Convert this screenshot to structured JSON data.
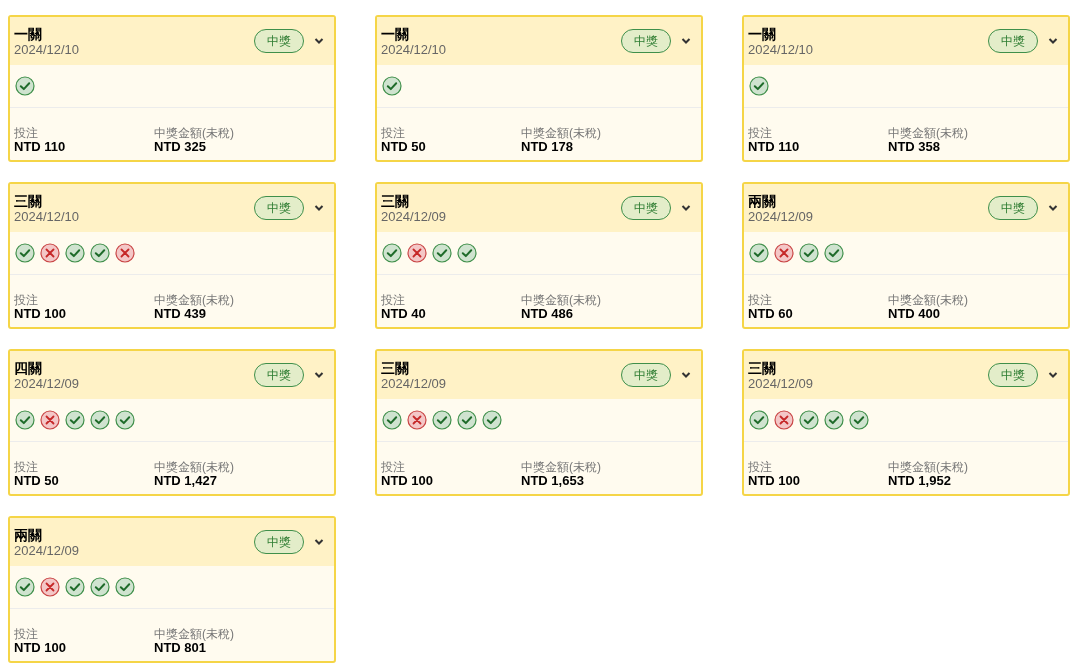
{
  "cards": [
    {
      "title": "一關",
      "date": "2024/12/10",
      "badge": "中獎",
      "results": [
        {
          "correct": true
        }
      ],
      "bet_label": "投注",
      "bet": "NTD 110",
      "prize_label": "中獎金額(未稅)",
      "prize": "NTD 325"
    },
    {
      "title": "一關",
      "date": "2024/12/10",
      "badge": "中獎",
      "results": [
        {
          "correct": true
        }
      ],
      "bet_label": "投注",
      "bet": "NTD 50",
      "prize_label": "中獎金額(未稅)",
      "prize": "NTD 178"
    },
    {
      "title": "一關",
      "date": "2024/12/10",
      "badge": "中獎",
      "results": [
        {
          "correct": true
        }
      ],
      "bet_label": "投注",
      "bet": "NTD 110",
      "prize_label": "中獎金額(未稅)",
      "prize": "NTD 358"
    },
    {
      "title": "三關",
      "date": "2024/12/10",
      "badge": "中獎",
      "results": [
        {
          "correct": true
        },
        {
          "correct": false
        },
        {
          "correct": true
        },
        {
          "correct": true
        },
        {
          "correct": false
        }
      ],
      "bet_label": "投注",
      "bet": "NTD 100",
      "prize_label": "中獎金額(未稅)",
      "prize": "NTD 439"
    },
    {
      "title": "三關",
      "date": "2024/12/09",
      "badge": "中獎",
      "results": [
        {
          "correct": true
        },
        {
          "correct": false
        },
        {
          "correct": true
        },
        {
          "correct": true
        }
      ],
      "bet_label": "投注",
      "bet": "NTD 40",
      "prize_label": "中獎金額(未稅)",
      "prize": "NTD 486"
    },
    {
      "title": "兩關",
      "date": "2024/12/09",
      "badge": "中獎",
      "results": [
        {
          "correct": true
        },
        {
          "correct": false
        },
        {
          "correct": true
        },
        {
          "correct": true
        }
      ],
      "bet_label": "投注",
      "bet": "NTD 60",
      "prize_label": "中獎金額(未稅)",
      "prize": "NTD 400"
    },
    {
      "title": "四關",
      "date": "2024/12/09",
      "badge": "中獎",
      "results": [
        {
          "correct": true
        },
        {
          "correct": false
        },
        {
          "correct": true
        },
        {
          "correct": true
        },
        {
          "correct": true
        }
      ],
      "bet_label": "投注",
      "bet": "NTD 50",
      "prize_label": "中獎金額(未稅)",
      "prize": "NTD 1,427"
    },
    {
      "title": "三關",
      "date": "2024/12/09",
      "badge": "中獎",
      "results": [
        {
          "correct": true
        },
        {
          "correct": false
        },
        {
          "correct": true
        },
        {
          "correct": true
        },
        {
          "correct": true
        }
      ],
      "bet_label": "投注",
      "bet": "NTD 100",
      "prize_label": "中獎金額(未稅)",
      "prize": "NTD 1,653"
    },
    {
      "title": "三關",
      "date": "2024/12/09",
      "badge": "中獎",
      "results": [
        {
          "correct": true
        },
        {
          "correct": false
        },
        {
          "correct": true
        },
        {
          "correct": true
        },
        {
          "correct": true
        }
      ],
      "bet_label": "投注",
      "bet": "NTD 100",
      "prize_label": "中獎金額(未稅)",
      "prize": "NTD 1,952"
    },
    {
      "title": "兩關",
      "date": "2024/12/09",
      "badge": "中獎",
      "results": [
        {
          "correct": true
        },
        {
          "correct": false
        },
        {
          "correct": true
        },
        {
          "correct": true
        },
        {
          "correct": true
        }
      ],
      "bet_label": "投注",
      "bet": "NTD 100",
      "prize_label": "中獎金額(未稅)",
      "prize": "NTD 801"
    }
  ]
}
